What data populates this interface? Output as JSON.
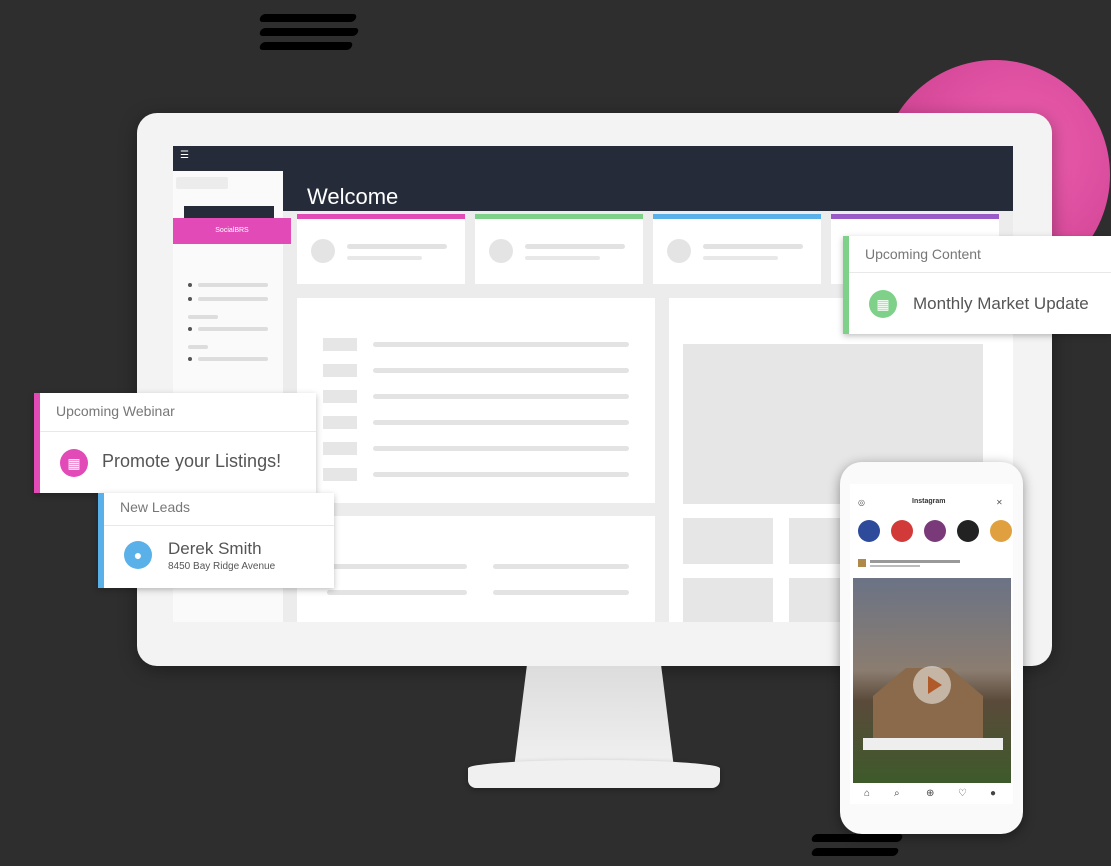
{
  "dashboard": {
    "menu_icon": "menu-icon",
    "welcome": "Welcome",
    "sidebar_active": "SocialBRS",
    "card_colors": [
      "#e24ab7",
      "#7fd18a",
      "#5ab0e8",
      "#9a5ac8"
    ]
  },
  "upcoming_content": {
    "heading": "Upcoming Content",
    "item": "Monthly Market Update",
    "icon": "calendar-icon",
    "accent": "#7fd18a"
  },
  "upcoming_webinar": {
    "heading": "Upcoming Webinar",
    "item": "Promote your Listings!",
    "icon": "calendar-icon",
    "accent": "#e24ab7"
  },
  "new_leads": {
    "heading": "New Leads",
    "name": "Derek Smith",
    "address": "8450 Bay Ridge Avenue",
    "icon": "user-icon",
    "accent": "#5ab0e8"
  },
  "phone": {
    "title": "Instagram",
    "stories": [
      {
        "color": "#2e4a9a"
      },
      {
        "color": "#d23a3a"
      },
      {
        "color": "#7a3a7a"
      },
      {
        "color": "#222222"
      },
      {
        "color": "#e0a040"
      }
    ]
  }
}
